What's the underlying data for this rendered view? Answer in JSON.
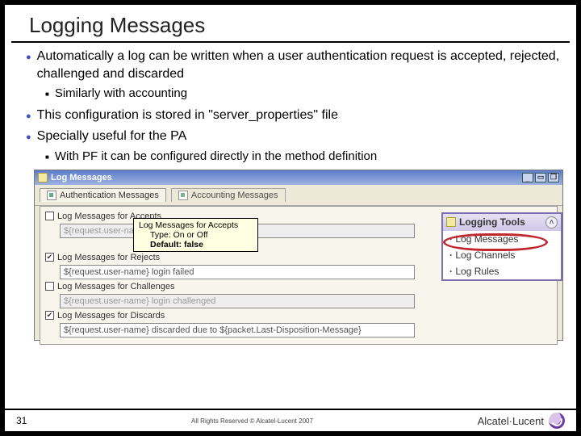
{
  "slide": {
    "title": "Logging Messages",
    "bullets": {
      "b1a": "Automatically a log can be written when a user authentication request is accepted, rejected, challenged and discarded",
      "b2a": "Similarly with accounting",
      "b1b": "This configuration is stored in \"server_properties\" file",
      "b1c": "Specially useful for the PA",
      "b2b": "With PF it can be configured directly in the method definition"
    }
  },
  "app": {
    "window_title": "Log Messages",
    "tabs": {
      "auth": "Authentication Messages",
      "acct": "Accounting Messages"
    },
    "fields": {
      "accepts_cb": "Log Messages for Accepts",
      "accepts_val": "${request.user-name} login OK",
      "rejects_cb": "Log Messages for Rejects",
      "rejects_val": "${request.user-name} login failed",
      "challenges_cb": "Log Messages for Challenges",
      "challenges_val": "${request.user-name} login challenged",
      "discards_cb": "Log Messages for Discards",
      "discards_val": "${request.user-name} discarded due to ${packet.Last-Disposition-Message}"
    },
    "tooltip": {
      "line1_label": "Log Messages for Accepts",
      "type": "Type: On or Off",
      "def": "Default: false"
    },
    "sidepanel": {
      "title": "Logging Tools",
      "items": [
        "Log Messages",
        "Log Channels",
        "Log Rules"
      ]
    }
  },
  "footer": {
    "page": "31",
    "copyright": "All Rights Reserved © Alcatel-Lucent 2007",
    "brand": "Alcatel·Lucent"
  }
}
